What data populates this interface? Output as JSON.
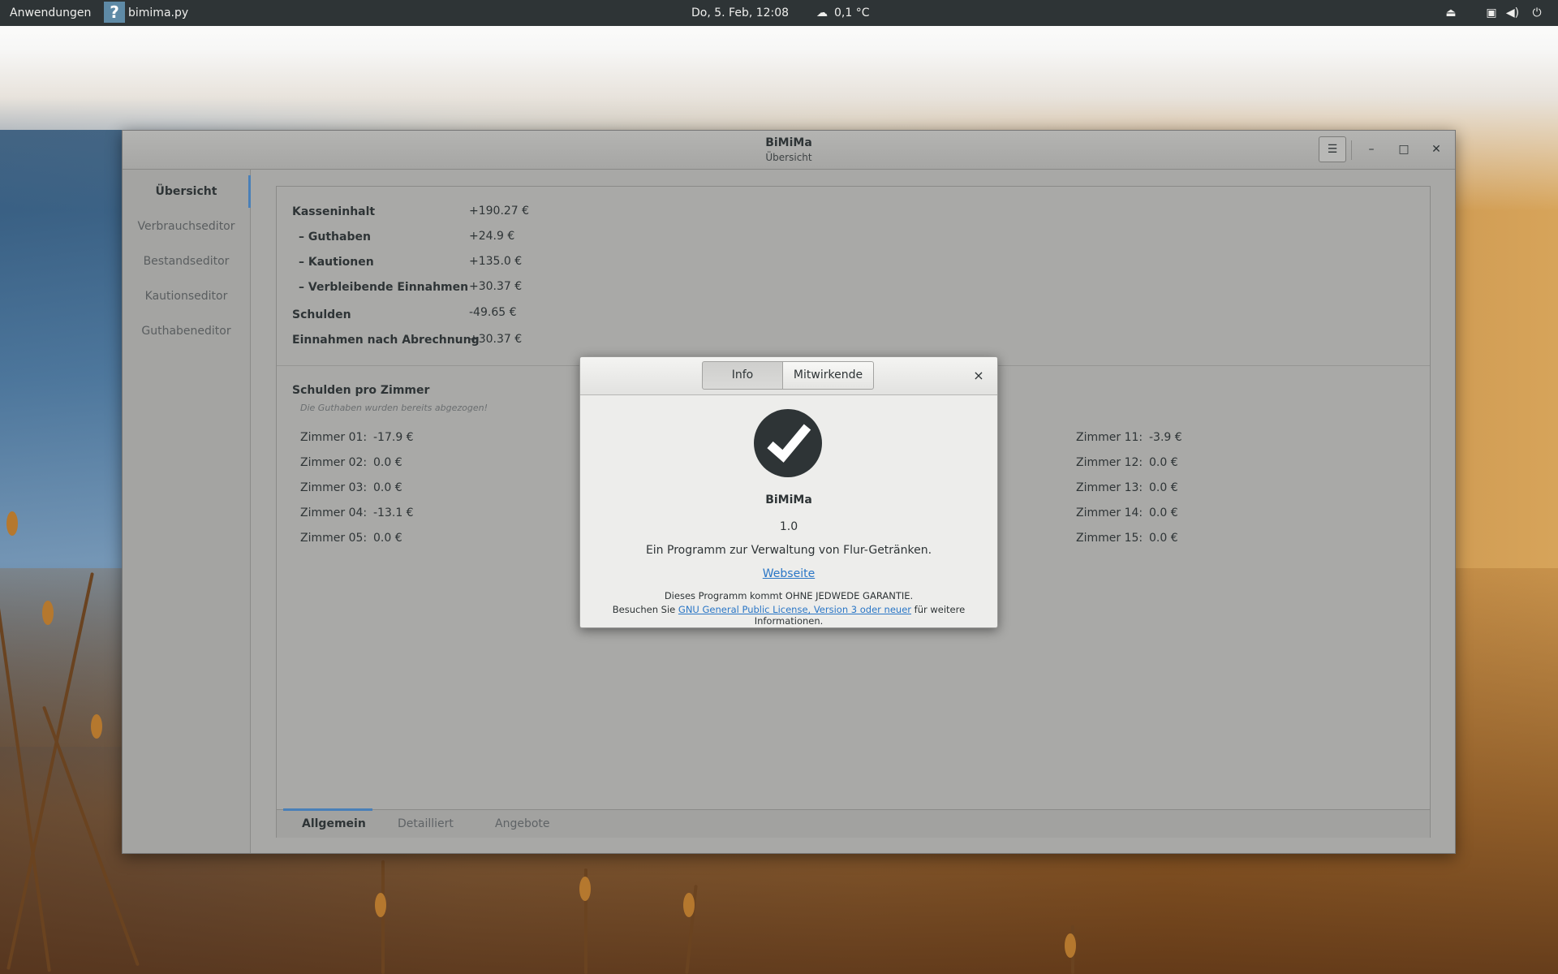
{
  "topbar": {
    "activities": "Anwendungen",
    "app_name": "bimima.py",
    "app_icon_glyph": "?",
    "clock": "Do,  5. Feb, 12:08",
    "weather": "0,1 °C",
    "tray_icons": [
      "eject-icon",
      "network-wired-icon",
      "volume-icon",
      "power-icon"
    ]
  },
  "window": {
    "title": "BiMiMa",
    "subtitle": "Übersicht"
  },
  "sidebar": {
    "items": [
      {
        "label": "Übersicht"
      },
      {
        "label": "Verbrauchseditor"
      },
      {
        "label": "Bestandseditor"
      },
      {
        "label": "Kautionseditor"
      },
      {
        "label": "Guthabeneditor"
      }
    ]
  },
  "summary": {
    "rows": [
      {
        "label": "Kasseninhalt",
        "value": "+190.27 €"
      },
      {
        "label": "– Guthaben",
        "value": "+24.9 €"
      },
      {
        "label": "– Kautionen",
        "value": "+135.0 €"
      },
      {
        "label": "– Verbleibende Einnahmen",
        "value": "+30.37 €"
      },
      {
        "label": "Schulden",
        "value": "-49.65 €"
      },
      {
        "label": "Einnahmen nach Abrechnung",
        "value": "+30.37 €"
      }
    ]
  },
  "rooms": {
    "heading": "Schulden pro Zimmer",
    "note": "Die Guthaben wurden bereits abgezogen!",
    "left": [
      {
        "label": "Zimmer 01:",
        "value": "-17.9 €"
      },
      {
        "label": "Zimmer 02:",
        "value": "0.0 €"
      },
      {
        "label": "Zimmer 03:",
        "value": "0.0 €"
      },
      {
        "label": "Zimmer 04:",
        "value": "-13.1 €"
      },
      {
        "label": "Zimmer 05:",
        "value": "0.0 €"
      }
    ],
    "right": [
      {
        "label": "Zimmer 11:",
        "value": "-3.9 €"
      },
      {
        "label": "Zimmer 12:",
        "value": "0.0 €"
      },
      {
        "label": "Zimmer 13:",
        "value": "0.0 €"
      },
      {
        "label": "Zimmer 14:",
        "value": "0.0 €"
      },
      {
        "label": "Zimmer 15:",
        "value": "0.0 €"
      }
    ]
  },
  "tabs": [
    {
      "label": "Allgemein"
    },
    {
      "label": "Detailliert"
    },
    {
      "label": "Angebote"
    }
  ],
  "about": {
    "tab_info": "Info",
    "tab_credits": "Mitwirkende",
    "close_glyph": "×",
    "program_name": "BiMiMa",
    "version": "1.0",
    "description": "Ein Programm zur Verwaltung von Flur-Getränken.",
    "website_link": "Webseite",
    "warranty": "Dieses Programm kommt OHNE JEDWEDE GARANTIE.",
    "license_prefix": "Besuchen Sie",
    "license_link": "GNU General Public License, Version 3 oder neuer",
    "license_suffix": "für weitere Informationen."
  },
  "glyphs": {
    "menu": "☰",
    "minimize": "–",
    "maximize": "□",
    "close": "✕",
    "eject": "⏏",
    "network": "▣",
    "volume": "◀)",
    "power": "⏻",
    "weather": "☁"
  },
  "colors": {
    "accent": "#4a80b8",
    "link": "#2a76c6",
    "topbar": "#2e3436"
  }
}
